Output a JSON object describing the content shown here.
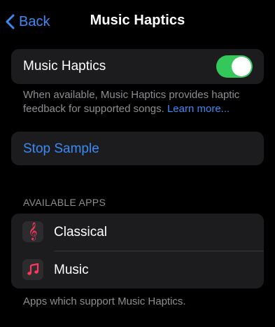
{
  "nav": {
    "back_label": "Back",
    "title": "Music Haptics"
  },
  "toggle": {
    "label": "Music Haptics",
    "state": "on",
    "color": "#34c759"
  },
  "description": {
    "text": "When available, Music Haptics provides haptic feedback for supported songs. ",
    "link": "Learn more..."
  },
  "stop_sample_label": "Stop Sample",
  "apps_section": {
    "header": "AVAILABLE APPS",
    "items": [
      {
        "label": "Classical",
        "icon": "treble-clef-icon"
      },
      {
        "label": "Music",
        "icon": "music-note-icon"
      }
    ],
    "footer": "Apps which support Music Haptics."
  },
  "colors": {
    "accent": "#3a8bf5",
    "background": "#000000",
    "card": "#1c1c1e",
    "secondary_text": "#8e8e93"
  }
}
